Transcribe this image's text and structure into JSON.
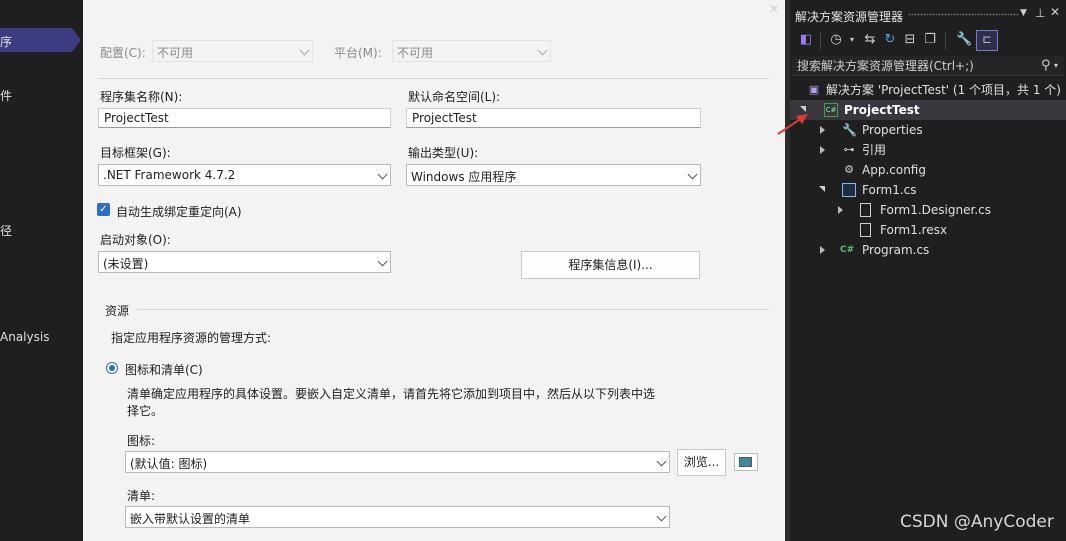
{
  "left_nav": {
    "items": [
      {
        "label": "序"
      },
      {
        "label": "件"
      },
      {
        "label": "径"
      },
      {
        "label": "Analysis"
      }
    ]
  },
  "main": {
    "close_glyph": "✕",
    "config": {
      "label": "配置(C):",
      "value": "不可用"
    },
    "platform": {
      "label": "平台(M):",
      "value": "不可用"
    },
    "assembly_name": {
      "label": "程序集名称(N):",
      "value": "ProjectTest"
    },
    "default_namespace": {
      "label": "默认命名空间(L):",
      "value": "ProjectTest"
    },
    "target_framework": {
      "label": "目标框架(G):",
      "value": ".NET Framework 4.7.2"
    },
    "output_type": {
      "label": "输出类型(U):",
      "value": "Windows 应用程序"
    },
    "auto_binding": {
      "label": "自动生成绑定重定向(A)",
      "checked": true
    },
    "startup_object": {
      "label": "启动对象(O):",
      "value": "(未设置)"
    },
    "assembly_info_button": "程序集信息(I)...",
    "resources": {
      "header": "资源",
      "description": "指定应用程序资源的管理方式:",
      "radio_label": "图标和清单(C)",
      "radio_help_line1": "清单确定应用程序的具体设置。要嵌入自定义清单，请首先将它添加到项目中，然后从以下列表中选",
      "radio_help_line2": "择它。",
      "icon_label": "图标:",
      "icon_value": "(默认值: 图标)",
      "browse_button": "浏览...",
      "manifest_label": "清单:",
      "manifest_value": "嵌入带默认设置的清单"
    }
  },
  "solution_explorer": {
    "title": "解决方案资源管理器",
    "search_placeholder": "搜索解决方案资源管理器(Ctrl+;)",
    "tree": [
      {
        "label": "解决方案 'ProjectTest' (1 个项目，共 1 个)"
      },
      {
        "label": "ProjectTest",
        "selected": true
      },
      {
        "label": "Properties"
      },
      {
        "label": "引用"
      },
      {
        "label": "App.config"
      },
      {
        "label": "Form1.cs"
      },
      {
        "label": "Form1.Designer.cs"
      },
      {
        "label": "Form1.resx"
      },
      {
        "label": "Program.cs"
      }
    ],
    "icons": {
      "cs_project": "C#",
      "cs_file": "C#"
    }
  },
  "watermark": "CSDN @AnyCoder",
  "colors": {
    "accent": "#2f6ec4",
    "nav_selected": "#3c3c82",
    "arrow": "#e03c2e"
  }
}
